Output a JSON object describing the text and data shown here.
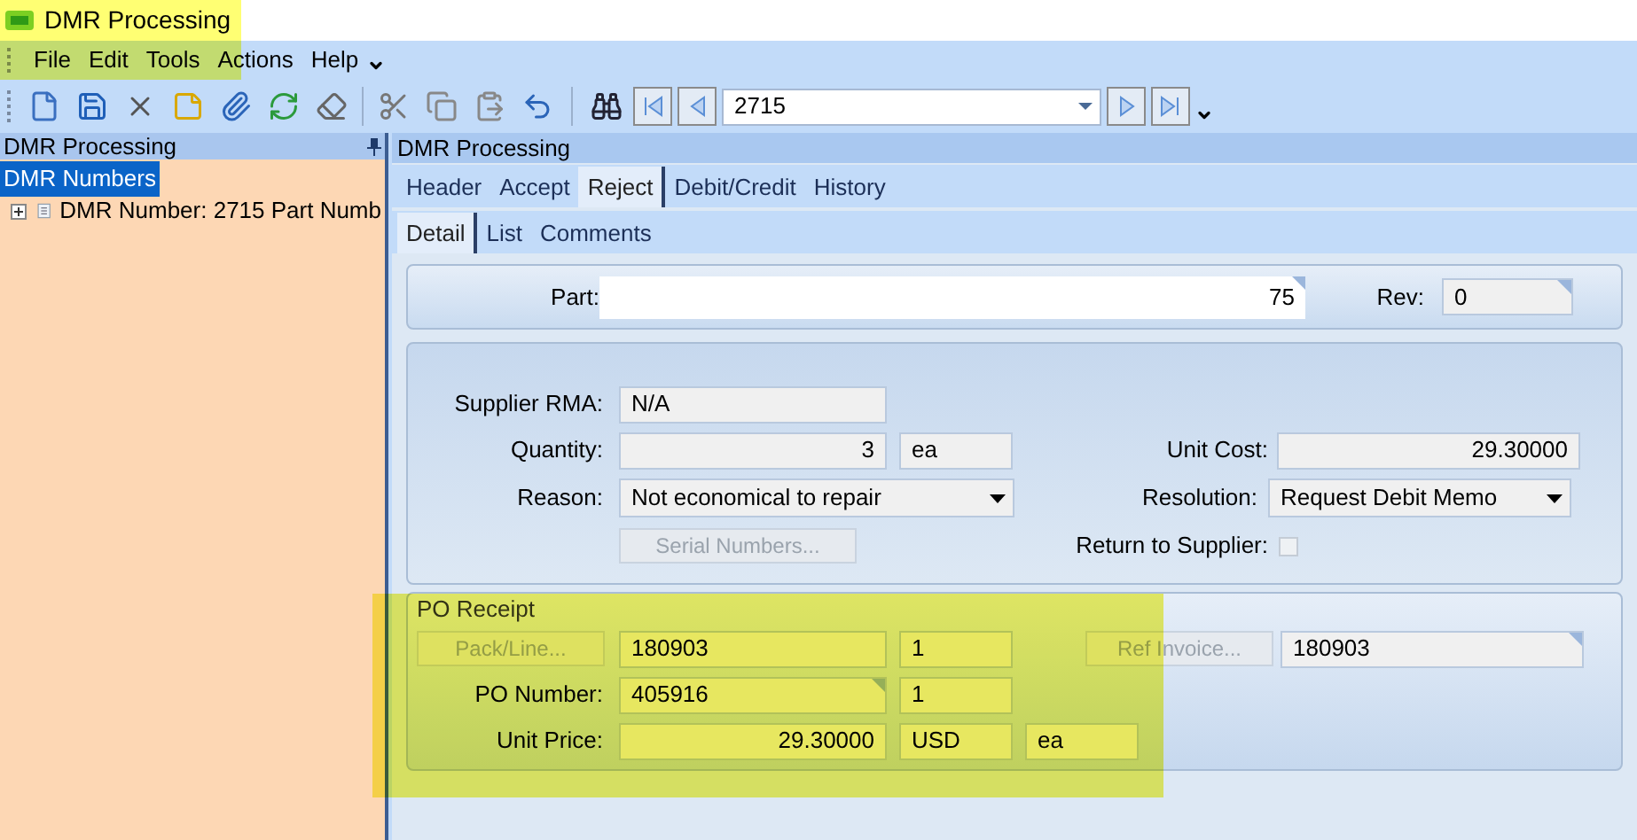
{
  "window": {
    "title": "DMR Processing"
  },
  "menu": [
    "File",
    "Edit",
    "Tools",
    "Actions",
    "Help"
  ],
  "toolbar": {
    "record": "2715"
  },
  "left_panel": {
    "title": "DMR Processing",
    "tree": [
      {
        "label": "DMR Numbers",
        "selected": true,
        "children": [
          {
            "label": "DMR Number: 2715 Part Numb",
            "selected": false,
            "expanded": false
          }
        ]
      }
    ]
  },
  "right_panel": {
    "title": "DMR Processing",
    "tabs": [
      {
        "label": "Header",
        "selected": false
      },
      {
        "label": "Accept",
        "selected": false
      },
      {
        "label": "Reject",
        "selected": true
      },
      {
        "label": "Debit/Credit",
        "selected": false
      },
      {
        "label": "History",
        "selected": false
      }
    ],
    "subtabs": [
      {
        "label": "Detail",
        "selected": true
      },
      {
        "label": "List",
        "selected": false
      },
      {
        "label": "Comments",
        "selected": false
      }
    ],
    "part": {
      "label": "Part:",
      "value": "75",
      "rev_label": "Rev:",
      "rev": "0"
    },
    "detail": {
      "supplier_rma": {
        "label": "Supplier RMA:",
        "value": "N/A"
      },
      "quantity": {
        "label": "Quantity:",
        "value": "3",
        "unit": "ea"
      },
      "unit_cost": {
        "label": "Unit Cost:",
        "value": "29.30000"
      },
      "reason": {
        "label": "Reason:",
        "value": "Not economical to repair"
      },
      "resolution": {
        "label": "Resolution:",
        "value": "Request Debit Memo"
      },
      "serial_numbers": {
        "label": "Serial Numbers...",
        "disabled": true
      },
      "return_to_supplier": {
        "label": "Return to Supplier:",
        "checked": false,
        "disabled": true
      }
    },
    "po_receipt": {
      "title": "PO Receipt",
      "pack_line": {
        "label": "Pack/Line...",
        "disabled": true,
        "pack": "180903",
        "line": "1"
      },
      "ref_invoice": {
        "label": "Ref Invoice...",
        "disabled": true,
        "value": "180903"
      },
      "po_number": {
        "label": "PO Number:",
        "value": "405916",
        "line": "1"
      },
      "unit_price": {
        "label": "Unit Price:",
        "value": "29.30000",
        "currency": "USD",
        "unit": "ea"
      }
    }
  },
  "highlights": {
    "title_area": true,
    "po_receipt": true
  }
}
